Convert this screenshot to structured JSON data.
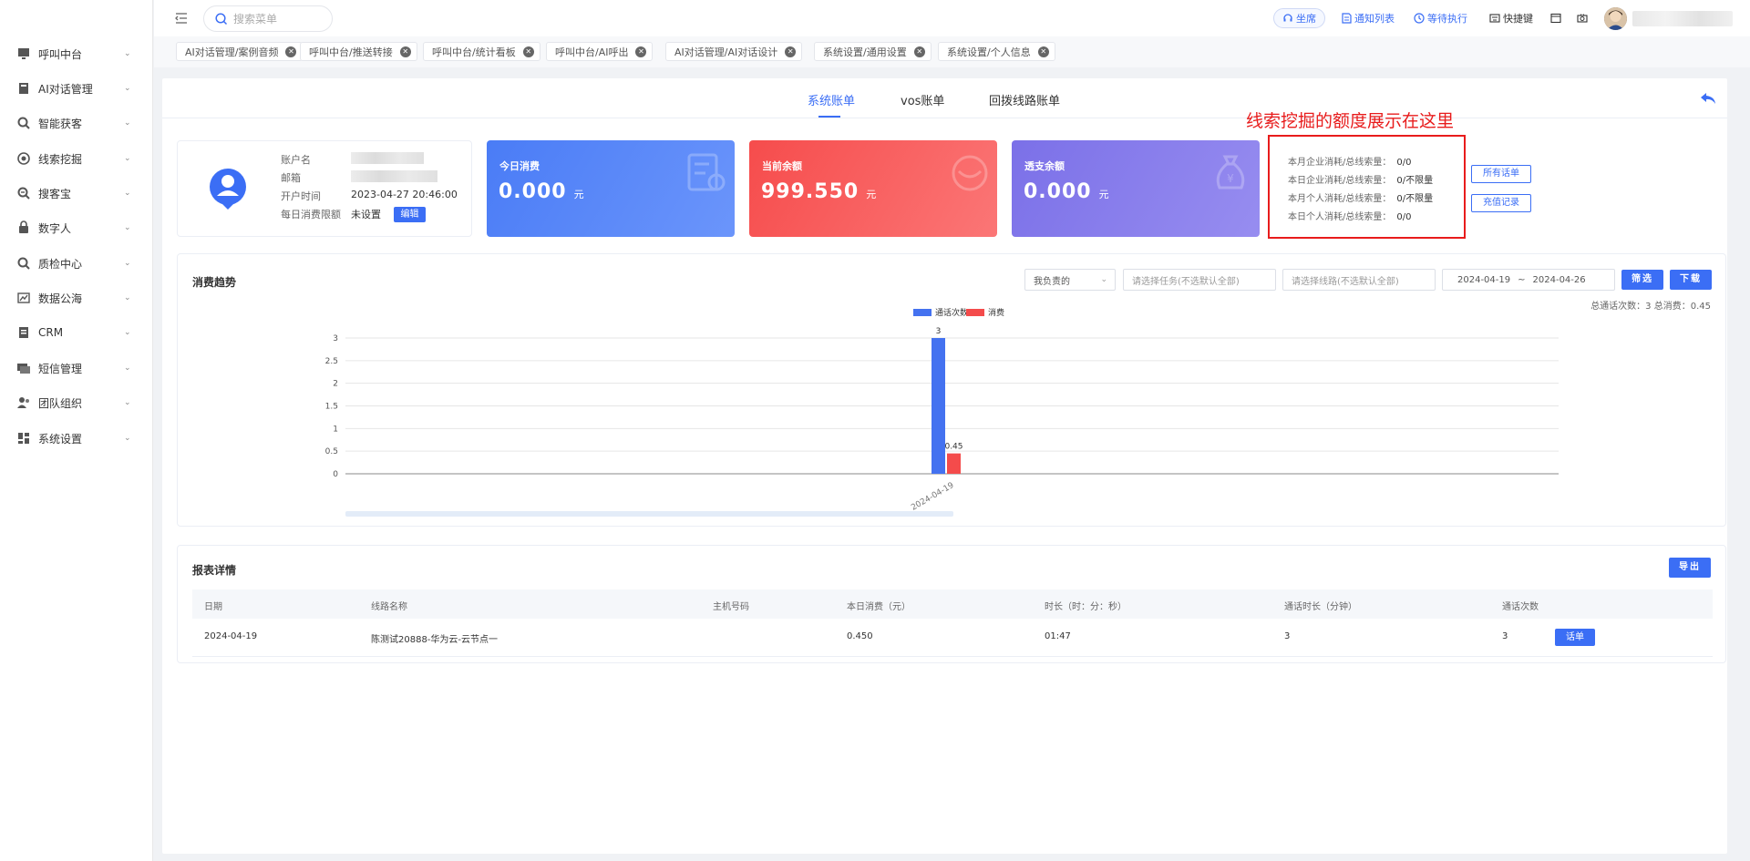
{
  "sidebar": {
    "items": [
      {
        "label": "呼叫中台",
        "icon": "monitor-icon"
      },
      {
        "label": "AI对话管理",
        "icon": "book-icon"
      },
      {
        "label": "智能获客",
        "icon": "magnifier-icon"
      },
      {
        "label": "线索挖掘",
        "icon": "target-icon"
      },
      {
        "label": "搜客宝",
        "icon": "search-zoom-icon"
      },
      {
        "label": "数字人",
        "icon": "lock-person-icon"
      },
      {
        "label": "质检中心",
        "icon": "inspect-icon"
      },
      {
        "label": "数据公海",
        "icon": "chart-icon"
      },
      {
        "label": "CRM",
        "icon": "crm-icon"
      },
      {
        "label": "短信管理",
        "icon": "message-icon"
      },
      {
        "label": "团队组织",
        "icon": "team-icon"
      },
      {
        "label": "系统设置",
        "icon": "grid-icon"
      }
    ]
  },
  "topbar": {
    "search_placeholder": "搜索菜单",
    "agent": "坐席",
    "notices": "通知列表",
    "pending": "等待执行",
    "shortcuts": "快捷键"
  },
  "tags": [
    "AI对话管理/案例音频",
    "呼叫中台/推送转接",
    "呼叫中台/统计看板",
    "呼叫中台/AI呼出",
    "AI对话管理/AI对话设计",
    "系统设置/通用设置",
    "系统设置/个人信息"
  ],
  "tabs": [
    "系统账单",
    "vos账单",
    "回拨线路账单"
  ],
  "account": {
    "name_label": "账户名",
    "email_label": "邮箱",
    "open_time_label": "开户时间",
    "open_time": "2023-04-27 20:46:00",
    "limit_label": "每日消费限额",
    "limit_value": "未设置",
    "edit": "编辑"
  },
  "stats": [
    {
      "title": "今日消费",
      "value": "0.000",
      "unit": "元",
      "color_from": "#4a7cf6",
      "color_to": "#6b95fb"
    },
    {
      "title": "当前余额",
      "value": "999.550",
      "unit": "元",
      "color_from": "#f64c4c",
      "color_to": "#fb7676"
    },
    {
      "title": "透支余额",
      "value": "0.000",
      "unit": "元",
      "color_from": "#7b70e8",
      "color_to": "#978df0"
    }
  ],
  "annotation": "线索挖掘的额度展示在这里",
  "quota": [
    {
      "label": "本月企业消耗/总线索量：",
      "value": "0/0"
    },
    {
      "label": "本日企业消耗/总线索量：",
      "value": "0/不限量"
    },
    {
      "label": "本月个人消耗/总线索量：",
      "value": "0/不限量"
    },
    {
      "label": "本日个人消耗/总线索量：",
      "value": "0/0"
    }
  ],
  "quota_buttons": {
    "all_bills": "所有话单",
    "recharge": "充值记录"
  },
  "trend": {
    "title": "消费趋势",
    "scope": "我负责的",
    "task_placeholder": "请选择任务(不选默认全部)",
    "line_placeholder": "请选择线路(不选默认全部)",
    "date_start": "2024-04-19",
    "date_sep": "~",
    "date_end": "2024-04-26",
    "filter": "筛选",
    "download": "下载",
    "totals": "总通话次数：3   总消费：0.45"
  },
  "chart_data": {
    "type": "bar",
    "categories": [
      "2024-04-19"
    ],
    "series": [
      {
        "name": "通话次数",
        "values": [
          3
        ],
        "color": "#4472f0"
      },
      {
        "name": "消费",
        "values": [
          0.45
        ],
        "color": "#f44b4b"
      }
    ],
    "ylim": [
      0,
      3
    ],
    "yticks": [
      "0",
      "0.5",
      "1",
      "1.5",
      "2",
      "2.5",
      "3"
    ],
    "data_labels": [
      "3",
      "0.45"
    ],
    "legend_position": "top-center",
    "grid": true
  },
  "report": {
    "title": "报表详情",
    "export": "导出",
    "columns": [
      "日期",
      "线路名称",
      "主机号码",
      "本日消费（元）",
      "时长（时：分：秒）",
      "通话时长（分钟）",
      "通话次数"
    ],
    "rows": [
      {
        "date": "2024-04-19",
        "line": "陈测试20888-华为云-云节点一",
        "host": "",
        "cost": "0.450",
        "duration": "01:47",
        "minutes": "3",
        "calls": "3",
        "action": "话单"
      }
    ]
  }
}
